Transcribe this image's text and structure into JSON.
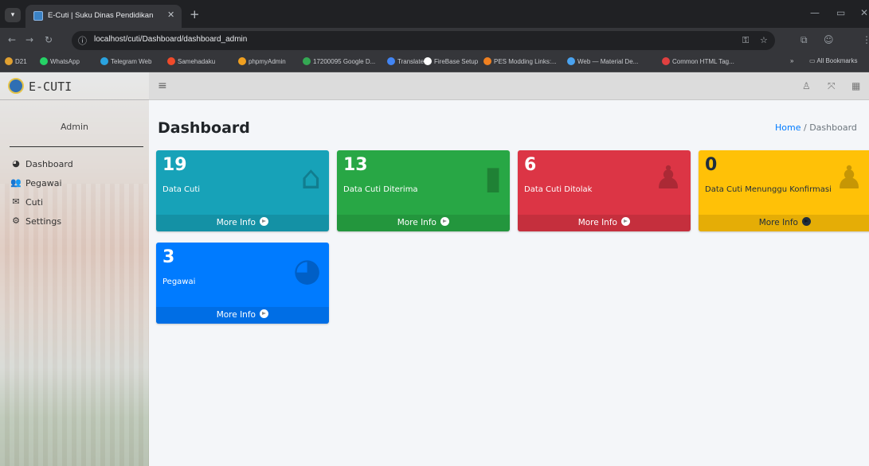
{
  "browser": {
    "tab_title": "E-Cuti | Suku Dinas Pendidikan",
    "tab_close": "✕",
    "new_tab": "+",
    "url": "localhost/cuti/Dashboard/dashboard_admin",
    "bookmarks": [
      {
        "label": "D21",
        "color": "#e0a030"
      },
      {
        "label": "WhatsApp",
        "color": "#25d366"
      },
      {
        "label": "Telegram Web",
        "color": "#2aa3e0"
      },
      {
        "label": "Samehadaku",
        "color": "#f04a2a"
      },
      {
        "label": "phpmyAdmin",
        "color": "#f0a020"
      },
      {
        "label": "17200095 Google D...",
        "color": "#34a853"
      },
      {
        "label": "Translate",
        "color": "#4285f4"
      },
      {
        "label": "FireBase Setup",
        "color": "#ffffff"
      },
      {
        "label": "PES Modding Links:...",
        "color": "#f08020"
      },
      {
        "label": "Web — Material De...",
        "color": "#4aa3f0"
      },
      {
        "label": "Common HTML Tag...",
        "color": "#e04040"
      }
    ],
    "all_bookmarks": "All Bookmarks",
    "more_bookmarks": "»"
  },
  "app": {
    "brand": "E-CUTI",
    "user_name": "Admin",
    "nav": [
      {
        "label": "Dashboard",
        "icon": "tachometer-icon"
      },
      {
        "label": "Pegawai",
        "icon": "users-icon"
      },
      {
        "label": "Cuti",
        "icon": "envelope-icon"
      },
      {
        "label": "Settings",
        "icon": "gear-icon"
      }
    ],
    "page_title": "Dashboard",
    "breadcrumb": {
      "home": "Home",
      "separator": "/",
      "current": "Dashboard"
    },
    "cards": [
      {
        "number": "19",
        "label": "Data Cuti",
        "more": "More Info",
        "color": "#17a2b8",
        "icon": "shopping-bag-icon"
      },
      {
        "number": "13",
        "label": "Data Cuti Diterima",
        "more": "More Info",
        "color": "#28a745",
        "icon": "bar-chart-icon"
      },
      {
        "number": "6",
        "label": "Data Cuti Ditolak",
        "more": "More Info",
        "color": "#dc3545",
        "icon": "user-plus-icon"
      },
      {
        "number": "0",
        "label": "Data Cuti Menunggu Konfirmasi",
        "more": "More Info",
        "color": "#ffc107",
        "icon": "user-plus-icon"
      },
      {
        "number": "3",
        "label": "Pegawai",
        "more": "More Info",
        "color": "#007bff",
        "icon": "pie-chart-icon"
      }
    ]
  }
}
